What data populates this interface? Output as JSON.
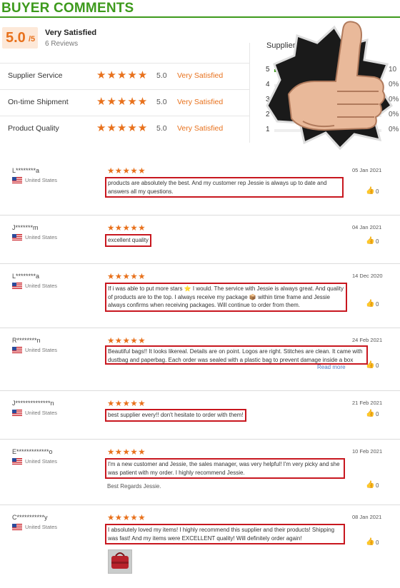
{
  "header": {
    "title": "BUYER COMMENTS"
  },
  "overall": {
    "score": "5.0",
    "out_of": "/5",
    "label": "Very Satisfied",
    "reviews": "6 Reviews"
  },
  "metrics": [
    {
      "label": "Supplier Service",
      "stars": "★★★★★",
      "value": "5.0",
      "text": "Very Satisfied"
    },
    {
      "label": "On-time Shipment",
      "stars": "★★★★★",
      "value": "5.0",
      "text": "Very Satisfied"
    },
    {
      "label": "Product Quality",
      "stars": "★★★★★",
      "value": "5.0",
      "text": "Very Satisfied"
    }
  ],
  "supplier_panel": {
    "title": "Supplier Service",
    "rows": [
      {
        "star": "5",
        "pct": "10",
        "fill": 1.0
      },
      {
        "star": "4",
        "pct": "0%",
        "fill": 0
      },
      {
        "star": "3",
        "pct": "0%",
        "fill": 0
      },
      {
        "star": "2",
        "pct": "0%",
        "fill": 0
      },
      {
        "star": "1",
        "pct": "0%",
        "fill": 0
      }
    ]
  },
  "colors": {
    "brand_green": "#3d9a1c",
    "accent_orange": "#e8711c",
    "highlight_red": "#c8171f"
  },
  "reviews": [
    {
      "user": "L********a",
      "country": "United States",
      "stars": "★★★★★",
      "date": "05 Jan 2021",
      "text": "products are absolutely the best. And my customer rep Jessie is always up to date and answers all my questions.",
      "likes": "0"
    },
    {
      "user": "J*******m",
      "country": "United States",
      "stars": "★★★★★",
      "date": "04 Jan 2021",
      "text": "excellent quality",
      "likes": "0"
    },
    {
      "user": "L********a",
      "country": "United States",
      "stars": "★★★★★",
      "date": "14 Dec 2020",
      "text": "If i was able to put more stars ⭐ I would. The service with Jessie is always great. And quality of products are to the top. I always receive my package 📦 within time frame and Jessie always confirms when receiving packages. Will continue to order from them.",
      "likes": "0"
    },
    {
      "user": "R********n",
      "country": "United States",
      "stars": "★★★★★",
      "date": "24 Feb 2021",
      "text": "Beautiful bags!! It looks likereal. Details are on point. Logos are right. Stitches are clean. It came with dustbag and paperbag. Each order was sealed with a plastic bag to prevent damage inside a box when arrived. I paid extra to also get authentication cards and receipts. Me...",
      "readmore": "Read more",
      "likes": "0"
    },
    {
      "user": "J**************n",
      "country": "United States",
      "stars": "★★★★★",
      "date": "21 Feb 2021",
      "text": "best supplier every!! don't hesitate to order with them!",
      "likes": "0"
    },
    {
      "user": "E*************o",
      "country": "United States",
      "stars": "★★★★★",
      "date": "10 Feb 2021",
      "text": "I'm a new customer and Jessie, the sales manager, was very helpful! I'm very picky and she was patient with my order. I highly recommend Jessie.",
      "extra": "Best Regards Jessie.",
      "likes": "0"
    },
    {
      "user": "C***********y",
      "country": "United States",
      "stars": "★★★★★",
      "date": "08 Jan 2021",
      "text": "I absolutely loved my items! I highly recommend this supplier and their products! Shipping was fast! And my items were EXCELLENT quality! Will definitely order again!",
      "likes": "0"
    }
  ]
}
